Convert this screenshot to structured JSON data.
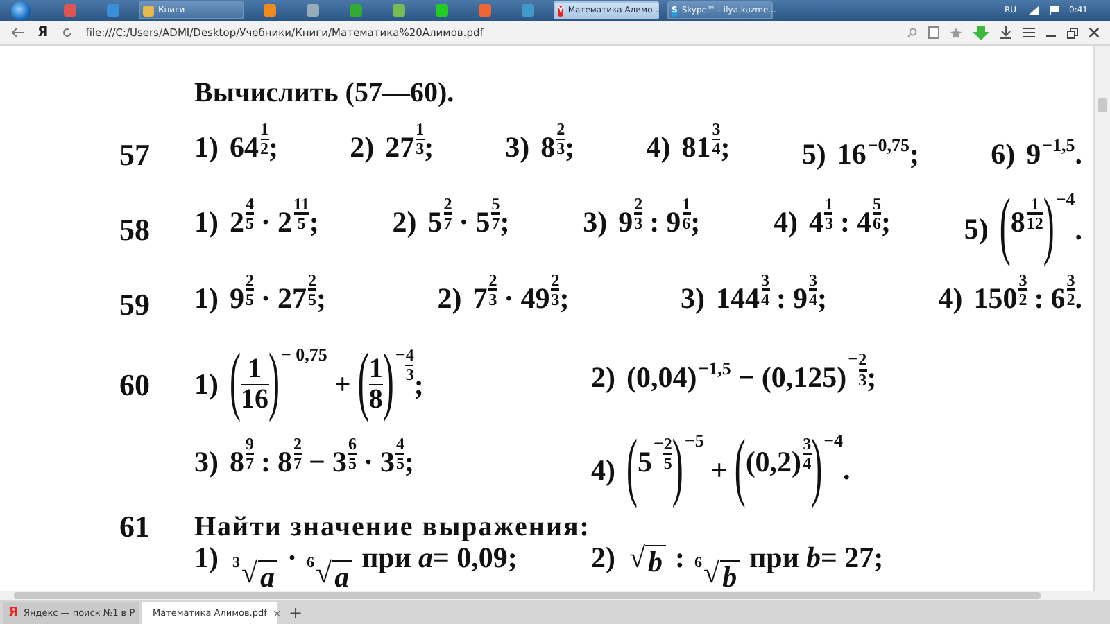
{
  "taskbar": {
    "tasks": [
      {
        "label": "Книги",
        "active": false,
        "kind": "folder"
      },
      {
        "label": "Математика Алимо...",
        "active": true,
        "kind": "browser",
        "letter": "Y"
      },
      {
        "label": "Skype™ - ilya.kuzme...",
        "active": false,
        "kind": "skype",
        "letter": "S"
      }
    ],
    "language": "RU",
    "clock": "0:41"
  },
  "browser": {
    "logo_letter": "Я",
    "url": "file:///C:/Users/ADMI/Desktop/Учебники/Книги/Математика%20Алимов.pdf",
    "tabs": [
      {
        "label": "Яндекс — поиск №1 в Р",
        "letter": "Я",
        "selected": false
      },
      {
        "label": "Математика Алимов.pdf",
        "selected": true
      }
    ],
    "new_tab": "+",
    "close_mark": "×"
  },
  "document": {
    "heading": "Вычислить (57—60).",
    "problems": [
      {
        "number": "57",
        "lines": [
          [
            {
              "label": "1)",
              "expr": [
                {
                  "kind": "p",
                  "b": [
                    {
                      "kind": "n",
                      "s": "64"
                    }
                  ],
                  "e": [
                    {
                      "kind": "f",
                      "num": [
                        {
                          "kind": "n",
                          "s": "1"
                        }
                      ],
                      "den": [
                        {
                          "kind": "n",
                          "s": "2"
                        }
                      ]
                    }
                  ]
                },
                {
                  "kind": "n",
                  "s": ";"
                }
              ]
            },
            {
              "label": "2)",
              "expr": [
                {
                  "kind": "p",
                  "b": [
                    {
                      "kind": "n",
                      "s": "27"
                    }
                  ],
                  "e": [
                    {
                      "kind": "f",
                      "num": [
                        {
                          "kind": "n",
                          "s": "1"
                        }
                      ],
                      "den": [
                        {
                          "kind": "n",
                          "s": "3"
                        }
                      ]
                    }
                  ]
                },
                {
                  "kind": "n",
                  "s": ";"
                }
              ]
            },
            {
              "label": "3)",
              "expr": [
                {
                  "kind": "p",
                  "b": [
                    {
                      "kind": "n",
                      "s": "8"
                    }
                  ],
                  "e": [
                    {
                      "kind": "f",
                      "num": [
                        {
                          "kind": "n",
                          "s": "2"
                        }
                      ],
                      "den": [
                        {
                          "kind": "n",
                          "s": "3"
                        }
                      ]
                    }
                  ]
                },
                {
                  "kind": "n",
                  "s": ";"
                }
              ]
            },
            {
              "label": "4)",
              "expr": [
                {
                  "kind": "p",
                  "b": [
                    {
                      "kind": "n",
                      "s": "81"
                    }
                  ],
                  "e": [
                    {
                      "kind": "f",
                      "num": [
                        {
                          "kind": "n",
                          "s": "3"
                        }
                      ],
                      "den": [
                        {
                          "kind": "n",
                          "s": "4"
                        }
                      ]
                    }
                  ]
                },
                {
                  "kind": "n",
                  "s": ";"
                }
              ]
            },
            {
              "label": "5)",
              "expr": [
                {
                  "kind": "p",
                  "b": [
                    {
                      "kind": "n",
                      "s": "16"
                    }
                  ],
                  "e": [
                    {
                      "kind": "n",
                      "s": "−0,75"
                    }
                  ]
                },
                {
                  "kind": "n",
                  "s": ";"
                }
              ]
            },
            {
              "label": "6)",
              "expr": [
                {
                  "kind": "p",
                  "b": [
                    {
                      "kind": "n",
                      "s": "9"
                    }
                  ],
                  "e": [
                    {
                      "kind": "n",
                      "s": "−1,5"
                    }
                  ]
                },
                {
                  "kind": "n",
                  "s": "."
                }
              ]
            }
          ]
        ]
      },
      {
        "number": "58",
        "lines": [
          [
            {
              "label": "1)",
              "expr": [
                {
                  "kind": "p",
                  "b": [
                    {
                      "kind": "n",
                      "s": "2"
                    }
                  ],
                  "e": [
                    {
                      "kind": "f",
                      "num": [
                        {
                          "kind": "n",
                          "s": "4"
                        }
                      ],
                      "den": [
                        {
                          "kind": "n",
                          "s": "5"
                        }
                      ]
                    }
                  ]
                },
                {
                  "kind": "n",
                  "s": "·"
                },
                {
                  "kind": "p",
                  "b": [
                    {
                      "kind": "n",
                      "s": "2"
                    }
                  ],
                  "e": [
                    {
                      "kind": "f",
                      "num": [
                        {
                          "kind": "n",
                          "s": "11"
                        }
                      ],
                      "den": [
                        {
                          "kind": "n",
                          "s": "5"
                        }
                      ]
                    }
                  ]
                },
                {
                  "kind": "n",
                  "s": ";"
                }
              ]
            },
            {
              "label": "2)",
              "expr": [
                {
                  "kind": "p",
                  "b": [
                    {
                      "kind": "n",
                      "s": "5"
                    }
                  ],
                  "e": [
                    {
                      "kind": "f",
                      "num": [
                        {
                          "kind": "n",
                          "s": "2"
                        }
                      ],
                      "den": [
                        {
                          "kind": "n",
                          "s": "7"
                        }
                      ]
                    }
                  ]
                },
                {
                  "kind": "n",
                  "s": "·"
                },
                {
                  "kind": "p",
                  "b": [
                    {
                      "kind": "n",
                      "s": "5"
                    }
                  ],
                  "e": [
                    {
                      "kind": "f",
                      "num": [
                        {
                          "kind": "n",
                          "s": "5"
                        }
                      ],
                      "den": [
                        {
                          "kind": "n",
                          "s": "7"
                        }
                      ]
                    }
                  ]
                },
                {
                  "kind": "n",
                  "s": ";"
                }
              ]
            },
            {
              "label": "3)",
              "expr": [
                {
                  "kind": "p",
                  "b": [
                    {
                      "kind": "n",
                      "s": "9"
                    }
                  ],
                  "e": [
                    {
                      "kind": "f",
                      "num": [
                        {
                          "kind": "n",
                          "s": "2"
                        }
                      ],
                      "den": [
                        {
                          "kind": "n",
                          "s": "3"
                        }
                      ]
                    }
                  ]
                },
                {
                  "kind": "n",
                  "s": ":"
                },
                {
                  "kind": "p",
                  "b": [
                    {
                      "kind": "n",
                      "s": "9"
                    }
                  ],
                  "e": [
                    {
                      "kind": "f",
                      "num": [
                        {
                          "kind": "n",
                          "s": "1"
                        }
                      ],
                      "den": [
                        {
                          "kind": "n",
                          "s": "6"
                        }
                      ]
                    }
                  ]
                },
                {
                  "kind": "n",
                  "s": ";"
                }
              ]
            },
            {
              "label": "4)",
              "expr": [
                {
                  "kind": "p",
                  "b": [
                    {
                      "kind": "n",
                      "s": "4"
                    }
                  ],
                  "e": [
                    {
                      "kind": "f",
                      "num": [
                        {
                          "kind": "n",
                          "s": "1"
                        }
                      ],
                      "den": [
                        {
                          "kind": "n",
                          "s": "3"
                        }
                      ]
                    }
                  ]
                },
                {
                  "kind": "n",
                  "s": ":"
                },
                {
                  "kind": "p",
                  "b": [
                    {
                      "kind": "n",
                      "s": "4"
                    }
                  ],
                  "e": [
                    {
                      "kind": "f",
                      "num": [
                        {
                          "kind": "n",
                          "s": "5"
                        }
                      ],
                      "den": [
                        {
                          "kind": "n",
                          "s": "6"
                        }
                      ]
                    }
                  ]
                },
                {
                  "kind": "n",
                  "s": ";"
                }
              ]
            },
            {
              "label": "5)",
              "expr": [
                {
                  "kind": "p",
                  "b": [
                    {
                      "kind": "g",
                      "open": "(",
                      "close": ")",
                      "body": [
                        {
                          "kind": "p",
                          "b": [
                            {
                              "kind": "n",
                              "s": "8"
                            }
                          ],
                          "e": [
                            {
                              "kind": "f",
                              "num": [
                                {
                                  "kind": "n",
                                  "s": "1"
                                }
                              ],
                              "den": [
                                {
                                  "kind": "n",
                                  "s": "12"
                                }
                              ]
                            }
                          ]
                        }
                      ]
                    }
                  ],
                  "e": [
                    {
                      "kind": "n",
                      "s": "−4"
                    }
                  ]
                },
                {
                  "kind": "n",
                  "s": "."
                }
              ]
            }
          ]
        ]
      },
      {
        "number": "59",
        "lines": [
          [
            {
              "label": "1)",
              "expr": [
                {
                  "kind": "p",
                  "b": [
                    {
                      "kind": "n",
                      "s": "9"
                    }
                  ],
                  "e": [
                    {
                      "kind": "f",
                      "num": [
                        {
                          "kind": "n",
                          "s": "2"
                        }
                      ],
                      "den": [
                        {
                          "kind": "n",
                          "s": "5"
                        }
                      ]
                    }
                  ]
                },
                {
                  "kind": "n",
                  "s": "·"
                },
                {
                  "kind": "p",
                  "b": [
                    {
                      "kind": "n",
                      "s": "27"
                    }
                  ],
                  "e": [
                    {
                      "kind": "f",
                      "num": [
                        {
                          "kind": "n",
                          "s": "2"
                        }
                      ],
                      "den": [
                        {
                          "kind": "n",
                          "s": "5"
                        }
                      ]
                    }
                  ]
                },
                {
                  "kind": "n",
                  "s": ";"
                }
              ]
            },
            {
              "label": "2)",
              "expr": [
                {
                  "kind": "p",
                  "b": [
                    {
                      "kind": "n",
                      "s": "7"
                    }
                  ],
                  "e": [
                    {
                      "kind": "f",
                      "num": [
                        {
                          "kind": "n",
                          "s": "2"
                        }
                      ],
                      "den": [
                        {
                          "kind": "n",
                          "s": "3"
                        }
                      ]
                    }
                  ]
                },
                {
                  "kind": "n",
                  "s": "·"
                },
                {
                  "kind": "p",
                  "b": [
                    {
                      "kind": "n",
                      "s": "49"
                    }
                  ],
                  "e": [
                    {
                      "kind": "f",
                      "num": [
                        {
                          "kind": "n",
                          "s": "2"
                        }
                      ],
                      "den": [
                        {
                          "kind": "n",
                          "s": "3"
                        }
                      ]
                    }
                  ]
                },
                {
                  "kind": "n",
                  "s": ";"
                }
              ]
            },
            {
              "label": "3)",
              "expr": [
                {
                  "kind": "p",
                  "b": [
                    {
                      "kind": "n",
                      "s": "144"
                    }
                  ],
                  "e": [
                    {
                      "kind": "f",
                      "num": [
                        {
                          "kind": "n",
                          "s": "3"
                        }
                      ],
                      "den": [
                        {
                          "kind": "n",
                          "s": "4"
                        }
                      ]
                    }
                  ]
                },
                {
                  "kind": "n",
                  "s": ":"
                },
                {
                  "kind": "p",
                  "b": [
                    {
                      "kind": "n",
                      "s": "9"
                    }
                  ],
                  "e": [
                    {
                      "kind": "f",
                      "num": [
                        {
                          "kind": "n",
                          "s": "3"
                        }
                      ],
                      "den": [
                        {
                          "kind": "n",
                          "s": "4"
                        }
                      ]
                    }
                  ]
                },
                {
                  "kind": "n",
                  "s": ";"
                }
              ]
            },
            {
              "label": "4)",
              "expr": [
                {
                  "kind": "p",
                  "b": [
                    {
                      "kind": "n",
                      "s": "150"
                    }
                  ],
                  "e": [
                    {
                      "kind": "f",
                      "num": [
                        {
                          "kind": "n",
                          "s": "3"
                        }
                      ],
                      "den": [
                        {
                          "kind": "n",
                          "s": "2"
                        }
                      ]
                    }
                  ]
                },
                {
                  "kind": "n",
                  "s": ":"
                },
                {
                  "kind": "p",
                  "b": [
                    {
                      "kind": "n",
                      "s": "6"
                    }
                  ],
                  "e": [
                    {
                      "kind": "f",
                      "num": [
                        {
                          "kind": "n",
                          "s": "3"
                        }
                      ],
                      "den": [
                        {
                          "kind": "n",
                          "s": "2"
                        }
                      ]
                    }
                  ]
                },
                {
                  "kind": "n",
                  "s": "."
                }
              ]
            }
          ]
        ]
      },
      {
        "number": "60",
        "lines": [
          [
            {
              "label": "1)",
              "expr": [
                {
                  "kind": "p",
                  "b": [
                    {
                      "kind": "g",
                      "open": "(",
                      "close": ")",
                      "body": [
                        {
                          "kind": "f",
                          "num": [
                            {
                              "kind": "n",
                              "s": "1"
                            }
                          ],
                          "den": [
                            {
                              "kind": "n",
                              "s": "16"
                            }
                          ]
                        }
                      ]
                    }
                  ],
                  "e": [
                    {
                      "kind": "n",
                      "s": "− 0,75"
                    }
                  ]
                },
                {
                  "kind": "n",
                  "s": "+"
                },
                {
                  "kind": "p",
                  "b": [
                    {
                      "kind": "g",
                      "open": "(",
                      "close": ")",
                      "body": [
                        {
                          "kind": "f",
                          "num": [
                            {
                              "kind": "n",
                              "s": "1"
                            }
                          ],
                          "den": [
                            {
                              "kind": "n",
                              "s": "8"
                            }
                          ]
                        }
                      ]
                    }
                  ],
                  "e": [
                    {
                      "kind": "n",
                      "s": "−"
                    },
                    {
                      "kind": "f",
                      "num": [
                        {
                          "kind": "n",
                          "s": "4"
                        }
                      ],
                      "den": [
                        {
                          "kind": "n",
                          "s": "3"
                        }
                      ]
                    }
                  ]
                },
                {
                  "kind": "n",
                  "s": ";"
                }
              ]
            },
            {
              "label": "2)",
              "expr": [
                {
                  "kind": "p",
                  "b": [
                    {
                      "kind": "n",
                      "s": "(0,04)"
                    }
                  ],
                  "e": [
                    {
                      "kind": "n",
                      "s": "−1,5"
                    }
                  ]
                },
                {
                  "kind": "n",
                  "s": "−"
                },
                {
                  "kind": "p",
                  "b": [
                    {
                      "kind": "n",
                      "s": "(0,125)"
                    }
                  ],
                  "e": [
                    {
                      "kind": "n",
                      "s": "−"
                    },
                    {
                      "kind": "f",
                      "num": [
                        {
                          "kind": "n",
                          "s": "2"
                        }
                      ],
                      "den": [
                        {
                          "kind": "n",
                          "s": "3"
                        }
                      ]
                    }
                  ]
                },
                {
                  "kind": "n",
                  "s": ";"
                }
              ]
            }
          ],
          [
            {
              "label": "3)",
              "expr": [
                {
                  "kind": "p",
                  "b": [
                    {
                      "kind": "n",
                      "s": "8"
                    }
                  ],
                  "e": [
                    {
                      "kind": "f",
                      "num": [
                        {
                          "kind": "n",
                          "s": "9"
                        }
                      ],
                      "den": [
                        {
                          "kind": "n",
                          "s": "7"
                        }
                      ]
                    }
                  ]
                },
                {
                  "kind": "n",
                  "s": ":"
                },
                {
                  "kind": "p",
                  "b": [
                    {
                      "kind": "n",
                      "s": "8"
                    }
                  ],
                  "e": [
                    {
                      "kind": "f",
                      "num": [
                        {
                          "kind": "n",
                          "s": "2"
                        }
                      ],
                      "den": [
                        {
                          "kind": "n",
                          "s": "7"
                        }
                      ]
                    }
                  ]
                },
                {
                  "kind": "n",
                  "s": "−"
                },
                {
                  "kind": "p",
                  "b": [
                    {
                      "kind": "n",
                      "s": "3"
                    }
                  ],
                  "e": [
                    {
                      "kind": "f",
                      "num": [
                        {
                          "kind": "n",
                          "s": "6"
                        }
                      ],
                      "den": [
                        {
                          "kind": "n",
                          "s": "5"
                        }
                      ]
                    }
                  ]
                },
                {
                  "kind": "n",
                  "s": "·"
                },
                {
                  "kind": "p",
                  "b": [
                    {
                      "kind": "n",
                      "s": "3"
                    }
                  ],
                  "e": [
                    {
                      "kind": "f",
                      "num": [
                        {
                          "kind": "n",
                          "s": "4"
                        }
                      ],
                      "den": [
                        {
                          "kind": "n",
                          "s": "5"
                        }
                      ]
                    }
                  ]
                },
                {
                  "kind": "n",
                  "s": ";"
                }
              ]
            },
            {
              "label": "4)",
              "expr": [
                {
                  "kind": "p",
                  "b": [
                    {
                      "kind": "g",
                      "open": "(",
                      "close": ")",
                      "body": [
                        {
                          "kind": "p",
                          "b": [
                            {
                              "kind": "n",
                              "s": "5"
                            }
                          ],
                          "e": [
                            {
                              "kind": "n",
                              "s": "−"
                            },
                            {
                              "kind": "f",
                              "num": [
                                {
                                  "kind": "n",
                                  "s": "2"
                                }
                              ],
                              "den": [
                                {
                                  "kind": "n",
                                  "s": "5"
                                }
                              ]
                            }
                          ]
                        }
                      ]
                    }
                  ],
                  "e": [
                    {
                      "kind": "n",
                      "s": "−5"
                    }
                  ]
                },
                {
                  "kind": "n",
                  "s": "+"
                },
                {
                  "kind": "p",
                  "b": [
                    {
                      "kind": "g",
                      "open": "(",
                      "close": ")",
                      "body": [
                        {
                          "kind": "p",
                          "b": [
                            {
                              "kind": "n",
                              "s": "(0,2)"
                            }
                          ],
                          "e": [
                            {
                              "kind": "f",
                              "num": [
                                {
                                  "kind": "n",
                                  "s": "3"
                                }
                              ],
                              "den": [
                                {
                                  "kind": "n",
                                  "s": "4"
                                }
                              ]
                            }
                          ]
                        }
                      ]
                    }
                  ],
                  "e": [
                    {
                      "kind": "n",
                      "s": "−4"
                    }
                  ]
                },
                {
                  "kind": "n",
                  "s": "."
                }
              ]
            }
          ]
        ]
      },
      {
        "number": "61",
        "task": "Найти значение выражения:",
        "lines": [
          [
            {
              "label": "1)",
              "expr": [
                {
                  "kind": "r",
                  "idx": "3",
                  "sign": "√",
                  "body": [
                    {
                      "kind": "v",
                      "s": "a"
                    }
                  ]
                },
                {
                  "kind": "n",
                  "s": "·"
                },
                {
                  "kind": "r",
                  "idx": "6",
                  "sign": "√",
                  "body": [
                    {
                      "kind": "v",
                      "s": "a"
                    }
                  ]
                },
                {
                  "kind": "n",
                  "s": "при"
                },
                {
                  "kind": "v",
                  "s": "a"
                },
                {
                  "kind": "n",
                  "s": "= 0,09;"
                }
              ]
            },
            {
              "label": "2)",
              "expr": [
                {
                  "kind": "r",
                  "sign": "√",
                  "body": [
                    {
                      "kind": "v",
                      "s": "b"
                    }
                  ]
                },
                {
                  "kind": "n",
                  "s": ":"
                },
                {
                  "kind": "r",
                  "idx": "6",
                  "sign": "√",
                  "body": [
                    {
                      "kind": "v",
                      "s": "b"
                    }
                  ]
                },
                {
                  "kind": "n",
                  "s": "при"
                },
                {
                  "kind": "v",
                  "s": "b"
                },
                {
                  "kind": "n",
                  "s": "= 27;"
                }
              ]
            }
          ]
        ]
      }
    ]
  }
}
